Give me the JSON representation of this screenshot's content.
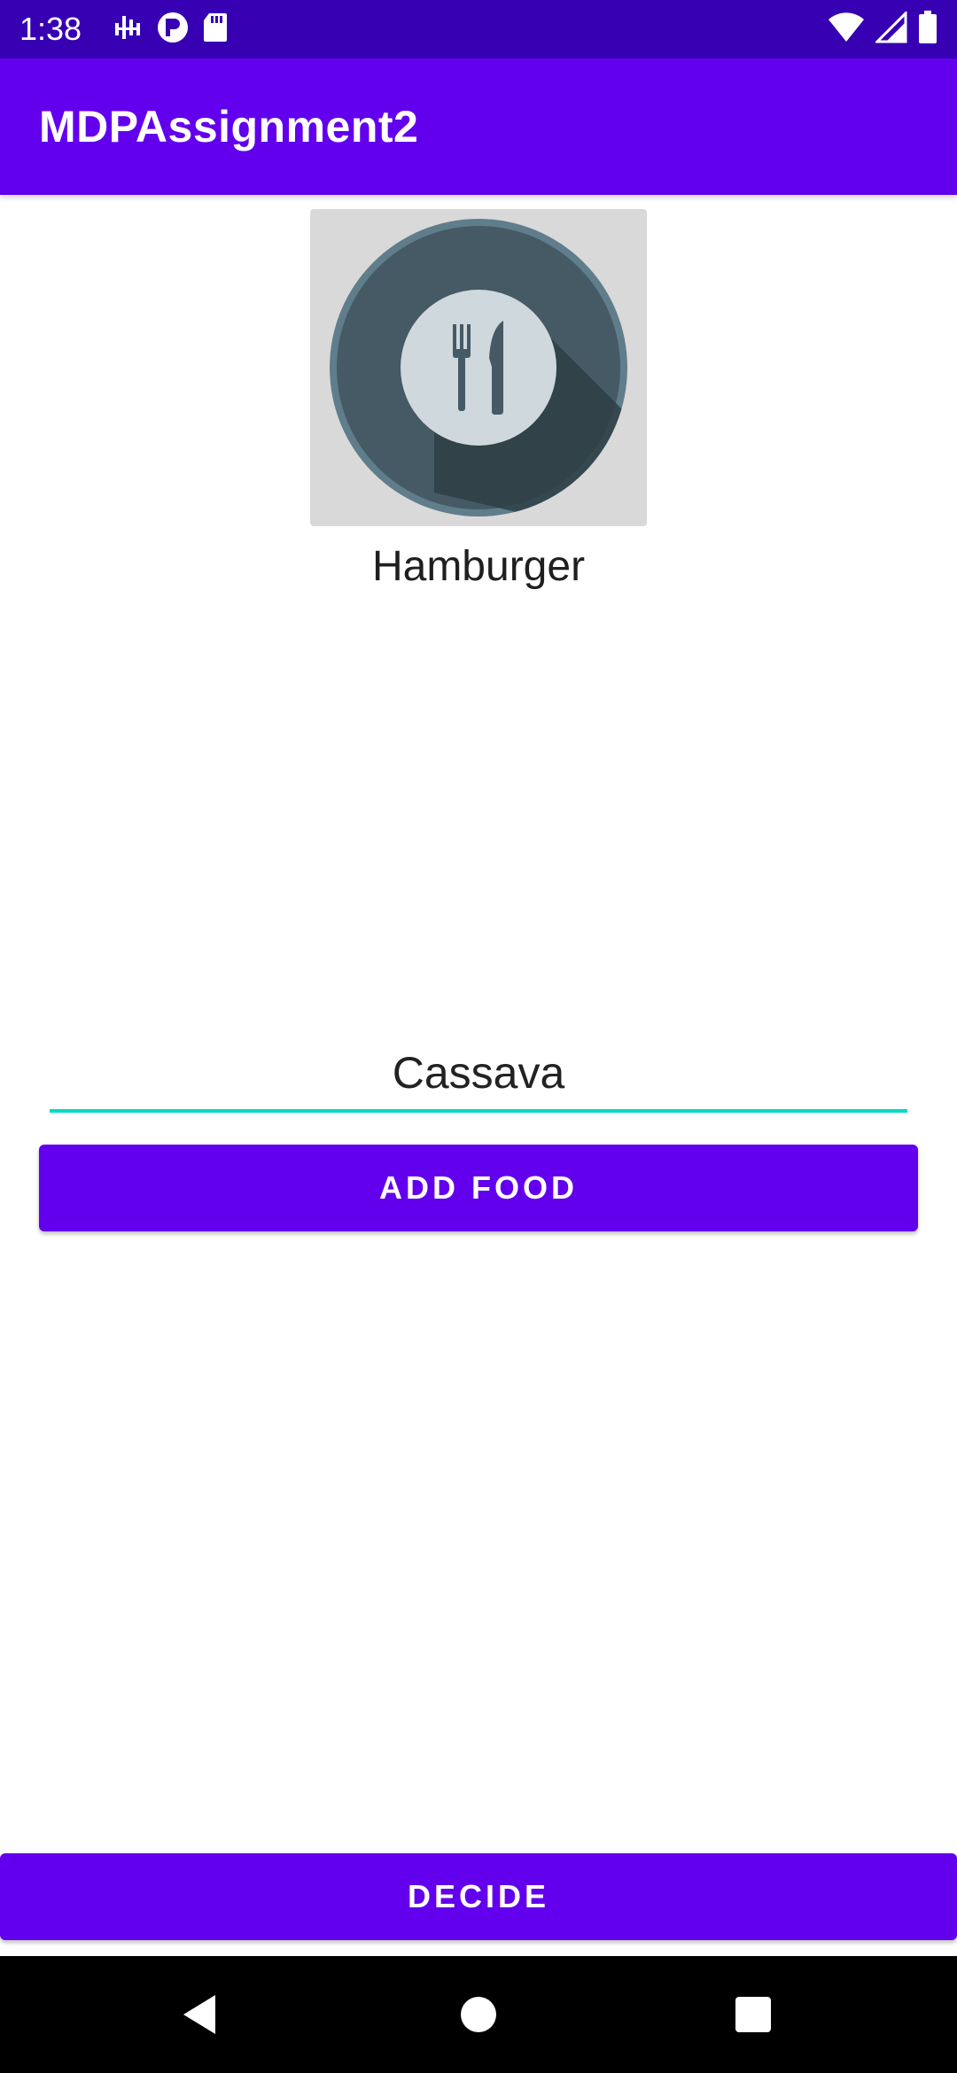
{
  "status_bar": {
    "time": "1:38",
    "left_icons": [
      "signal-tower-icon",
      "circle-p-icon",
      "sd-card-icon"
    ],
    "right_icons": [
      "wifi-icon",
      "cell-signal-icon",
      "battery-icon"
    ]
  },
  "app_bar": {
    "title": "MDPAssignment2"
  },
  "food": {
    "image_icon": "plate-fork-knife-icon",
    "name": "Hamburger"
  },
  "input": {
    "value": "Cassava"
  },
  "buttons": {
    "add_food": "ADD FOOD",
    "decide": "DECIDE"
  },
  "navigation": {
    "icons": [
      "back-icon",
      "home-icon",
      "recents-icon"
    ]
  },
  "colors": {
    "primary": "#6200ee",
    "primary_dark": "#3700b3",
    "accent": "#03dac5"
  }
}
